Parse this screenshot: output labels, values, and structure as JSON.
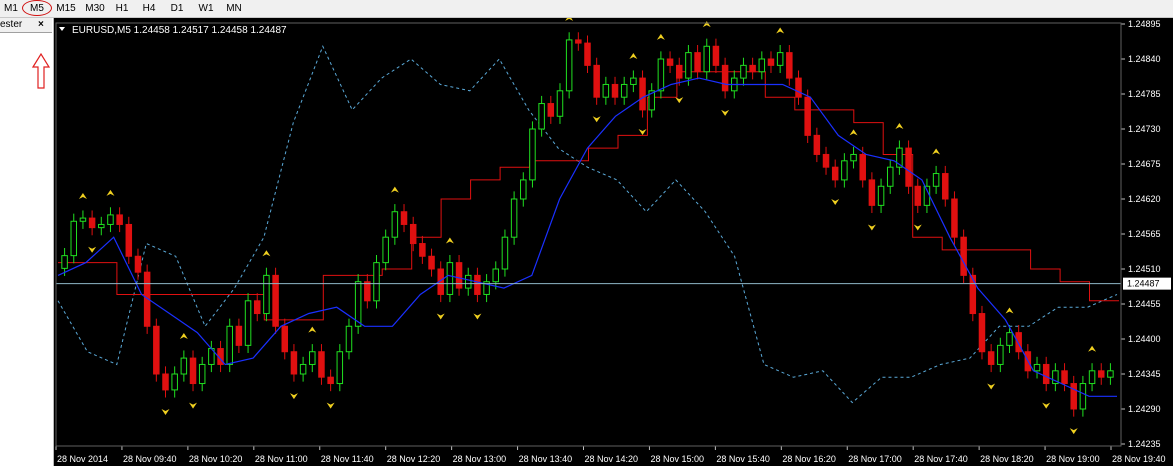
{
  "toolbar": {
    "timeframes": [
      "M1",
      "M5",
      "M15",
      "M30",
      "H1",
      "H4",
      "D1",
      "W1",
      "MN"
    ],
    "selected": "M5"
  },
  "tester_tab": {
    "label": "ester",
    "close": "×"
  },
  "chart_data": {
    "type": "candlestick",
    "title": "EURUSD,M5  1.24458 1.24517 1.24458 1.24487",
    "current_price": 1.24487,
    "current_price_label": "1.24487",
    "ylim": [
      1.24235,
      1.24895
    ],
    "y_ticks": [
      "1.24895",
      "1.24840",
      "1.24785",
      "1.24730",
      "1.24675",
      "1.24620",
      "1.24565",
      "1.24510",
      "1.24455",
      "1.24400",
      "1.24345",
      "1.24290",
      "1.24235"
    ],
    "x_labels": [
      "28 Nov 2014",
      "28 Nov 09:40",
      "28 Nov 10:20",
      "28 Nov 11:00",
      "28 Nov 11:40",
      "28 Nov 12:20",
      "28 Nov 13:00",
      "28 Nov 13:40",
      "28 Nov 14:20",
      "28 Nov 15:00",
      "28 Nov 15:40",
      "28 Nov 16:20",
      "28 Nov 17:00",
      "28 Nov 17:40",
      "28 Nov 18:20",
      "28 Nov 19:00",
      "28 Nov 19:40"
    ],
    "candles_close": [
      1.24531,
      1.24585,
      1.2459,
      1.24575,
      1.2458,
      1.24595,
      1.2458,
      1.2453,
      1.24505,
      1.2442,
      1.24345,
      1.2432,
      1.24345,
      1.2437,
      1.2433,
      1.2436,
      1.24385,
      1.2436,
      1.2442,
      1.2439,
      1.2446,
      1.2444,
      1.245,
      1.2442,
      1.2438,
      1.24345,
      1.2436,
      1.2438,
      1.2434,
      1.2433,
      1.2438,
      1.2442,
      1.2449,
      1.2446,
      1.2452,
      1.2456,
      1.246,
      1.2458,
      1.2455,
      1.2453,
      1.2451,
      1.2447,
      1.2452,
      1.2448,
      1.245,
      1.2447,
      1.2449,
      1.2451,
      1.2456,
      1.2462,
      1.2465,
      1.2473,
      1.2477,
      1.2475,
      1.2479,
      1.2487,
      1.24865,
      1.2483,
      1.2478,
      1.248,
      1.2478,
      1.248,
      1.2481,
      1.2476,
      1.2479,
      1.2484,
      1.2483,
      1.2481,
      1.2485,
      1.2482,
      1.2486,
      1.2483,
      1.2479,
      1.2481,
      1.2483,
      1.2482,
      1.2484,
      1.2483,
      1.2485,
      1.2481,
      1.2478,
      1.2472,
      1.2469,
      1.2467,
      1.2465,
      1.2468,
      1.2469,
      1.2465,
      1.2461,
      1.2464,
      1.2467,
      1.247,
      1.2464,
      1.2461,
      1.2464,
      1.2466,
      1.2462,
      1.2456,
      1.245,
      1.2444,
      1.2438,
      1.2436,
      1.2439,
      1.2441,
      1.2438,
      1.2435,
      1.2436,
      1.2433,
      1.2435,
      1.2433,
      1.2429,
      1.2433,
      1.2435,
      1.2434,
      1.2435
    ],
    "red_channel": [
      1.2452,
      1.2452,
      1.2447,
      1.2447,
      1.2447,
      1.2447,
      1.2447,
      1.2443,
      1.2443,
      1.245,
      1.245,
      1.2451,
      1.2456,
      1.2462,
      1.2465,
      1.2467,
      1.2468,
      1.2468,
      1.247,
      1.2472,
      1.2478,
      1.2482,
      1.2482,
      1.2482,
      1.2478,
      1.2476,
      1.2476,
      1.2474,
      1.2469,
      1.2456,
      1.2454,
      1.2454,
      1.2454,
      1.2451,
      1.2449,
      1.2446
    ],
    "blue_line": [
      1.245,
      1.2452,
      1.2456,
      1.2447,
      1.2444,
      1.2441,
      1.2436,
      1.2437,
      1.2442,
      1.2444,
      1.2445,
      1.2442,
      1.2442,
      1.2447,
      1.245,
      1.2449,
      1.2448,
      1.245,
      1.2462,
      1.247,
      1.2475,
      1.2478,
      1.248,
      1.2481,
      1.248,
      1.248,
      1.248,
      1.2478,
      1.2472,
      1.2469,
      1.2468,
      1.2465,
      1.2456,
      1.2448,
      1.2443,
      1.2435,
      1.2433,
      1.2431,
      1.2431
    ],
    "dashed_cyan": [
      1.2446,
      1.2438,
      1.2436,
      1.2455,
      1.2453,
      1.2442,
      1.2448,
      1.2456,
      1.2474,
      1.2486,
      1.2476,
      1.2481,
      1.2484,
      1.248,
      1.2479,
      1.2484,
      1.2476,
      1.247,
      1.2467,
      1.2465,
      1.246,
      1.2465,
      1.246,
      1.2453,
      1.2436,
      1.2434,
      1.2435,
      1.243,
      1.2434,
      1.2434,
      1.2436,
      1.2437,
      1.2442,
      1.2442,
      1.2445,
      1.2445,
      1.2447
    ]
  }
}
